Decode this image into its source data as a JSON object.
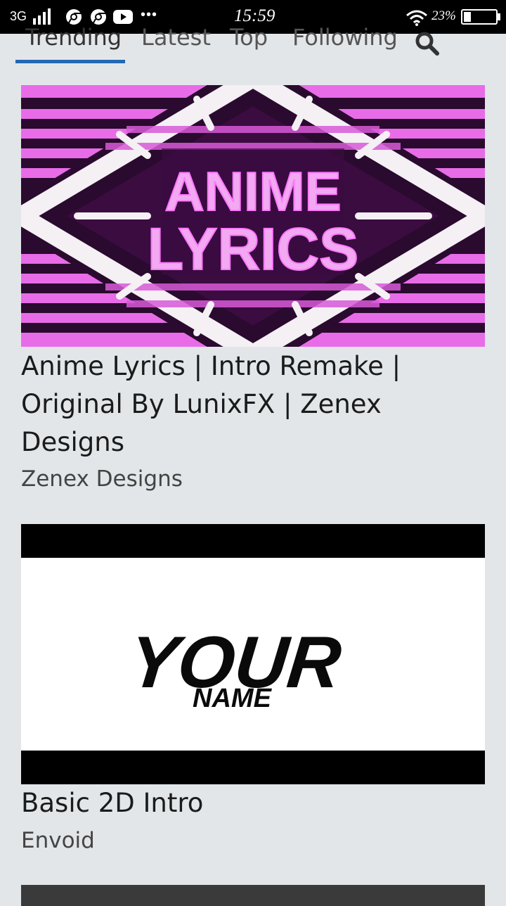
{
  "status_bar": {
    "network": "3G",
    "time": "15:59",
    "battery_percent": "23%",
    "battery_level": 0.23,
    "overflow_dots": "•••"
  },
  "tabs": [
    {
      "label": "Trending",
      "active": true
    },
    {
      "label": "Latest",
      "active": false
    },
    {
      "label": "Top",
      "active": false
    },
    {
      "label": "Following",
      "active": false
    }
  ],
  "accent_color": "#2468b3",
  "cards": [
    {
      "thumbnail_text": [
        "ANIME",
        "LYRICS"
      ],
      "title": "Anime Lyrics | Intro Remake | Original By LunixFX | Zenex Designs",
      "author": "Zenex Designs"
    },
    {
      "thumbnail_text": [
        "YOUR",
        "NAME"
      ],
      "title": "Basic 2D Intro",
      "author": "Envoid"
    }
  ]
}
